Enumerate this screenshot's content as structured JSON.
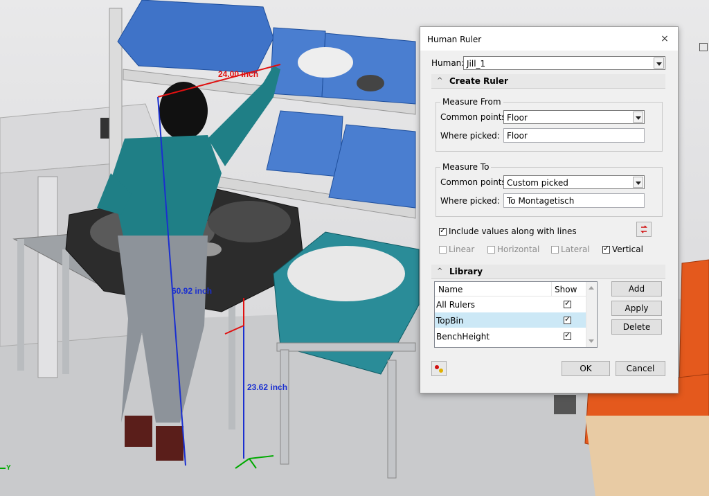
{
  "measurements": {
    "reach": "24.00 inch",
    "height": "60.92 inch",
    "bench": "23.62 inch"
  },
  "axis": {
    "y_label": "Y"
  },
  "dialog": {
    "title": "Human Ruler",
    "close_label": "×",
    "human_label": "Human:",
    "human_value": "Jill_1",
    "create_ruler": {
      "title": "Create Ruler",
      "measure_from": {
        "title": "Measure From",
        "common_label": "Common points:",
        "common_value": "Floor",
        "where_label": "Where picked:",
        "where_value": "Floor"
      },
      "measure_to": {
        "title": "Measure To",
        "common_label": "Common points:",
        "common_value": "Custom picked",
        "where_label": "Where picked:",
        "where_value": "To Montagetisch"
      },
      "include_values": {
        "label": "Include values along with lines",
        "checked": true
      },
      "options": [
        {
          "label": "Linear",
          "checked": false
        },
        {
          "label": "Horizontal",
          "checked": false
        },
        {
          "label": "Lateral",
          "checked": false
        },
        {
          "label": "Vertical",
          "checked": true
        }
      ]
    },
    "library": {
      "title": "Library",
      "columns": [
        "Name",
        "Show"
      ],
      "rows": [
        {
          "name": "All Rulers",
          "show": true
        },
        {
          "name": "TopBin",
          "show": true
        },
        {
          "name": "BenchHeight",
          "show": true
        }
      ],
      "buttons": {
        "add": "Add",
        "apply": "Apply",
        "delete": "Delete"
      }
    },
    "ok_label": "OK",
    "cancel_label": "Cancel"
  },
  "colors": {
    "blue_bin": "#3f73c8",
    "teal_bin": "#2a8c98",
    "orange_bin": "#e4591d",
    "ruler_red": "#e01010",
    "ruler_blue": "#1a2fd0",
    "shirt": "#1f7f86"
  }
}
